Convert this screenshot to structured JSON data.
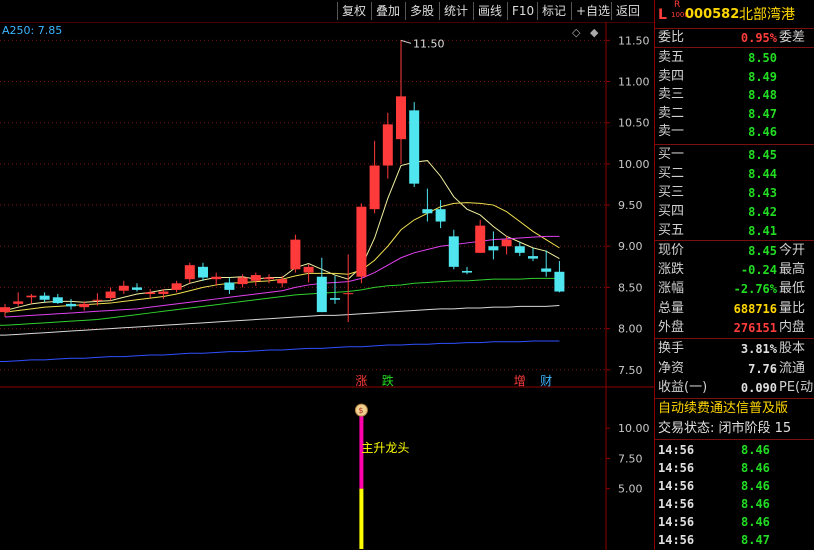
{
  "toolbar": {
    "buttons": [
      "复权",
      "叠加",
      "多股",
      "统计",
      "画线",
      "F10",
      "标记",
      "+自选",
      "返回"
    ]
  },
  "ma_label": "A250: 7.85",
  "header": {
    "l_mark": "L",
    "r_mark": "R",
    "r_sub": "1000",
    "stock_code": "000582",
    "stock_name": "北部湾港"
  },
  "quote": {
    "weibi_label": "委比",
    "weibi_value": "0.95%",
    "weicha_label": "委差",
    "asks": [
      {
        "label": "卖五",
        "price": "8.50"
      },
      {
        "label": "卖四",
        "price": "8.49"
      },
      {
        "label": "卖三",
        "price": "8.48"
      },
      {
        "label": "卖二",
        "price": "8.47"
      },
      {
        "label": "卖一",
        "price": "8.46"
      }
    ],
    "bids": [
      {
        "label": "买一",
        "price": "8.45"
      },
      {
        "label": "买二",
        "price": "8.44"
      },
      {
        "label": "买三",
        "price": "8.43"
      },
      {
        "label": "买四",
        "price": "8.42"
      },
      {
        "label": "买五",
        "price": "8.41"
      }
    ],
    "stats": [
      {
        "label": "现价",
        "value": "8.45",
        "label2": "今开",
        "color": "green"
      },
      {
        "label": "涨跌",
        "value": "-0.24",
        "label2": "最高",
        "color": "green"
      },
      {
        "label": "涨幅",
        "value": "-2.76%",
        "label2": "最低",
        "color": "green"
      },
      {
        "label": "总量",
        "value": "688716",
        "label2": "量比",
        "color": "yellow"
      },
      {
        "label": "外盘",
        "value": "276151",
        "label2": "内盘",
        "color": "red"
      }
    ],
    "stats2": [
      {
        "label": "换手",
        "value": "3.81%",
        "label2": "股本",
        "color": "white"
      },
      {
        "label": "净资",
        "value": "7.76",
        "label2": "流通",
        "color": "white"
      },
      {
        "label": "收益(一)",
        "value": "0.090",
        "label2": "PE(动)",
        "color": "white"
      }
    ],
    "scroll_text": "自动续费通达信普及版",
    "trade_status": "交易状态: 闭市阶段 15"
  },
  "ticks": [
    {
      "time": "14:56",
      "price": "8.46"
    },
    {
      "time": "14:56",
      "price": "8.46"
    },
    {
      "time": "14:56",
      "price": "8.46"
    },
    {
      "time": "14:56",
      "price": "8.46"
    },
    {
      "time": "14:56",
      "price": "8.46"
    },
    {
      "time": "14:56",
      "price": "8.47"
    }
  ],
  "chart_data": [
    {
      "type": "candlestick",
      "title": "",
      "ylim": [
        7.4,
        11.65
      ],
      "y_ticks": [
        "11.50",
        "11.00",
        "10.50",
        "10.00",
        "9.50",
        "9.00",
        "8.50",
        "8.00",
        "7.50"
      ],
      "y_tick_values": [
        11.5,
        11.0,
        10.5,
        10.0,
        9.5,
        9.0,
        8.5,
        8.0,
        7.5
      ],
      "peak_label": "11.50",
      "ohlc": [
        [
          8.2,
          8.3,
          8.14,
          8.26
        ],
        [
          8.3,
          8.44,
          8.27,
          8.33
        ],
        [
          8.38,
          8.42,
          8.3,
          8.4
        ],
        [
          8.4,
          8.44,
          8.32,
          8.35
        ],
        [
          8.38,
          8.42,
          8.3,
          8.31
        ],
        [
          8.3,
          8.36,
          8.23,
          8.27
        ],
        [
          8.26,
          8.33,
          8.22,
          8.3
        ],
        [
          8.34,
          8.43,
          8.28,
          8.35
        ],
        [
          8.37,
          8.5,
          8.34,
          8.45
        ],
        [
          8.46,
          8.58,
          8.42,
          8.52
        ],
        [
          8.5,
          8.55,
          8.45,
          8.47
        ],
        [
          8.42,
          8.48,
          8.37,
          8.44
        ],
        [
          8.42,
          8.48,
          8.36,
          8.45
        ],
        [
          8.47,
          8.58,
          8.44,
          8.55
        ],
        [
          8.6,
          8.8,
          8.55,
          8.77
        ],
        [
          8.75,
          8.8,
          8.58,
          8.62
        ],
        [
          8.6,
          8.68,
          8.52,
          8.63
        ],
        [
          8.56,
          8.62,
          8.42,
          8.47
        ],
        [
          8.54,
          8.66,
          8.5,
          8.62
        ],
        [
          8.58,
          8.68,
          8.52,
          8.65
        ],
        [
          8.6,
          8.66,
          8.55,
          8.62
        ],
        [
          8.55,
          8.64,
          8.5,
          8.6
        ],
        [
          8.72,
          9.14,
          8.68,
          9.08
        ],
        [
          8.68,
          8.78,
          8.56,
          8.75
        ],
        [
          8.63,
          8.86,
          8.2,
          8.2
        ],
        [
          8.37,
          8.64,
          8.3,
          8.35
        ],
        [
          8.43,
          8.9,
          8.08,
          8.43
        ],
        [
          8.63,
          9.52,
          8.55,
          9.48
        ],
        [
          9.45,
          10.28,
          9.4,
          9.98
        ],
        [
          9.98,
          10.62,
          9.82,
          10.48
        ],
        [
          10.3,
          11.5,
          10.0,
          10.82
        ],
        [
          10.65,
          10.75,
          9.72,
          9.76
        ],
        [
          9.45,
          9.7,
          9.3,
          9.4
        ],
        [
          9.45,
          9.56,
          9.22,
          9.3
        ],
        [
          9.12,
          9.2,
          8.72,
          8.75
        ],
        [
          8.7,
          8.75,
          8.66,
          8.68
        ],
        [
          8.92,
          9.32,
          8.92,
          9.25
        ],
        [
          9.0,
          9.18,
          8.84,
          8.95
        ],
        [
          9.0,
          9.12,
          8.9,
          9.08
        ],
        [
          9.0,
          9.05,
          8.88,
          8.92
        ],
        [
          8.88,
          8.98,
          8.82,
          8.85
        ],
        [
          8.73,
          8.95,
          8.63,
          8.69
        ],
        [
          8.69,
          8.82,
          8.44,
          8.45
        ]
      ],
      "ma_lines": [
        {
          "name": "MA5",
          "color": "#f0f0a0",
          "values": [
            8.22,
            8.26,
            8.3,
            8.32,
            8.33,
            8.33,
            8.32,
            8.33,
            8.34,
            8.38,
            8.42,
            8.44,
            8.47,
            8.48,
            8.55,
            8.59,
            8.62,
            8.62,
            8.63,
            8.6,
            8.62,
            8.62,
            8.74,
            8.79,
            8.72,
            8.65,
            8.6,
            8.75,
            9.1,
            9.58,
            9.98,
            10.02,
            10.04,
            9.85,
            9.6,
            9.45,
            9.38,
            9.24,
            9.12,
            9.05,
            8.98,
            8.94,
            8.85
          ]
        },
        {
          "name": "MA10",
          "color": "#f0e050",
          "values": [
            8.2,
            8.22,
            8.24,
            8.26,
            8.27,
            8.28,
            8.29,
            8.3,
            8.31,
            8.33,
            8.35,
            8.37,
            8.39,
            8.42,
            8.46,
            8.5,
            8.53,
            8.55,
            8.56,
            8.57,
            8.58,
            8.6,
            8.64,
            8.67,
            8.67,
            8.67,
            8.66,
            8.71,
            8.83,
            9.0,
            9.2,
            9.32,
            9.4,
            9.48,
            9.52,
            9.53,
            9.52,
            9.5,
            9.42,
            9.3,
            9.18,
            9.08,
            8.98
          ]
        },
        {
          "name": "MA20",
          "color": "#e040f0",
          "values": [
            8.14,
            8.15,
            8.16,
            8.17,
            8.18,
            8.19,
            8.2,
            8.21,
            8.22,
            8.23,
            8.24,
            8.26,
            8.28,
            8.3,
            8.32,
            8.34,
            8.36,
            8.38,
            8.4,
            8.42,
            8.44,
            8.46,
            8.5,
            8.53,
            8.55,
            8.56,
            8.57,
            8.61,
            8.68,
            8.77,
            8.86,
            8.92,
            8.96,
            9.0,
            9.02,
            9.04,
            9.06,
            9.08,
            9.09,
            9.1,
            9.11,
            9.12,
            9.12
          ]
        },
        {
          "name": "MA60",
          "color": "#30d030",
          "values": [
            8.04,
            8.05,
            8.06,
            8.07,
            8.08,
            8.09,
            8.1,
            8.11,
            8.13,
            8.15,
            8.17,
            8.19,
            8.21,
            8.23,
            8.25,
            8.27,
            8.29,
            8.31,
            8.33,
            8.35,
            8.37,
            8.39,
            8.41,
            8.42,
            8.43,
            8.44,
            8.45,
            8.47,
            8.5,
            8.52,
            8.53,
            8.55,
            8.56,
            8.57,
            8.58,
            8.58,
            8.59,
            8.6,
            8.6,
            8.6,
            8.61,
            8.61,
            8.61
          ]
        },
        {
          "name": "MA120",
          "color": "#d8d8d8",
          "values": [
            7.92,
            7.93,
            7.94,
            7.95,
            7.96,
            7.97,
            7.98,
            7.99,
            8.0,
            8.01,
            8.02,
            8.03,
            8.04,
            8.05,
            8.06,
            8.07,
            8.08,
            8.09,
            8.1,
            8.11,
            8.12,
            8.13,
            8.14,
            8.15,
            8.16,
            8.16,
            8.17,
            8.18,
            8.19,
            8.2,
            8.21,
            8.22,
            8.23,
            8.24,
            8.24,
            8.25,
            8.25,
            8.26,
            8.26,
            8.27,
            8.27,
            8.27,
            8.28
          ]
        },
        {
          "name": "A250",
          "color": "#3050ff",
          "values": [
            7.6,
            7.61,
            7.62,
            7.62,
            7.63,
            7.64,
            7.64,
            7.65,
            7.66,
            7.66,
            7.67,
            7.68,
            7.68,
            7.69,
            7.7,
            7.7,
            7.71,
            7.72,
            7.72,
            7.73,
            7.74,
            7.74,
            7.75,
            7.76,
            7.76,
            7.77,
            7.78,
            7.78,
            7.79,
            7.8,
            7.8,
            7.81,
            7.81,
            7.82,
            7.82,
            7.83,
            7.83,
            7.84,
            7.84,
            7.84,
            7.85,
            7.85,
            7.85
          ]
        }
      ],
      "markers": [
        {
          "index": 27,
          "text": "涨",
          "color": "#ff3c3c"
        },
        {
          "index": 29,
          "text": "跌",
          "color": "#22dd22"
        },
        {
          "index": 39,
          "text": "增",
          "color": "#ff3c3c"
        },
        {
          "index": 41,
          "text": "财",
          "color": "#3cb4ff"
        }
      ]
    },
    {
      "type": "bar",
      "title": "",
      "ylim": [
        0,
        13
      ],
      "y_ticks": [
        "10.00",
        "7.50",
        "5.00"
      ],
      "y_tick_values": [
        10.0,
        7.5,
        5.0
      ],
      "bar_index": 27,
      "segments": [
        {
          "from": 0,
          "to": 5,
          "color": "#ffff00"
        },
        {
          "from": 5,
          "to": 11,
          "color": "#ff00aa"
        }
      ],
      "annotation": "主升龙头"
    }
  ]
}
